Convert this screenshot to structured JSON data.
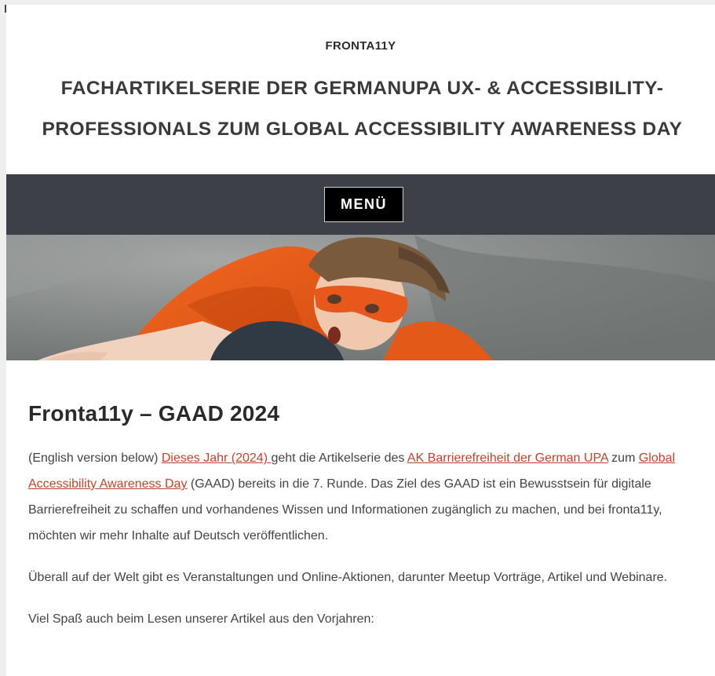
{
  "site": {
    "title": "FRONTA11Y",
    "description_line1": "FACHARTIKELSERIE DER GERMANUPA UX- & ACCESSIBILITY-",
    "description_line2": "PROFESSIONALS ZUM GLOBAL ACCESSIBILITY AWARENESS DAY"
  },
  "nav": {
    "menu_label": "MENÜ"
  },
  "hero": {
    "image": "hero-child-with-orange-cape-and-mask"
  },
  "colors": {
    "link": "#c0462a",
    "nav_bg": "#3d4147",
    "accent_orange": "#e8581c"
  },
  "article": {
    "title": "Fronta11y – GAAD 2024",
    "p1": {
      "t1": "(English version below) ",
      "link1": "Dieses Jahr (2024) ",
      "t2": "geht die Artikelserie des ",
      "link2": "AK Barrierefreiheit der German UPA",
      "t3": " zum ",
      "link3": "Global Accessibility Awareness Day",
      "t4": " (GAAD) bereits in die 7. Runde. Das Ziel des GAAD ist ein Bewusstsein für digitale Barrierefreiheit zu schaffen und vorhandenes Wissen und Informationen zugänglich zu machen, und bei fronta11y, möchten wir mehr Inhalte auf Deutsch veröffentlichen."
    },
    "p2": "Überall auf der Welt gibt es Veranstaltungen und Online-Aktionen, darunter Meetup Vorträge, Artikel und Webinare.",
    "p3": "Viel Spaß auch beim Lesen unserer Artikel aus den Vorjahren:"
  }
}
